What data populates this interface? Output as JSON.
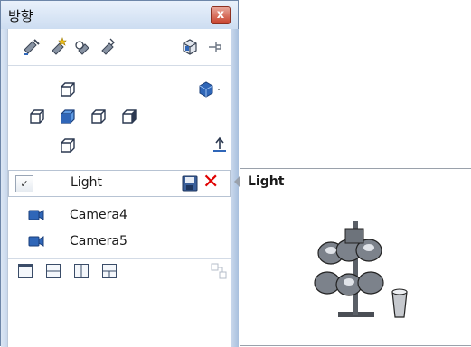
{
  "window": {
    "title": "방향",
    "close_label": "x"
  },
  "toolbar": {
    "icons": [
      "camera-new-icon",
      "camera-star-icon",
      "camera-previous-icon",
      "camera-link-icon",
      "view-cube-icon",
      "pin-icon"
    ]
  },
  "views": {
    "icons": [
      "top-view-icon",
      "display-style-dropdown-icon",
      "left-view-icon",
      "front-view-icon",
      "right-view-icon",
      "back-view-icon",
      "bottom-view-icon",
      "normal-to-icon"
    ]
  },
  "saved_views": {
    "editing": {
      "check": "✓",
      "name": "Light"
    },
    "items": [
      {
        "name": "Camera4"
      },
      {
        "name": "Camera5"
      }
    ]
  },
  "layout": {
    "icons": [
      "single-viewport-icon",
      "two-horizontal-viewports-icon",
      "two-vertical-viewports-icon",
      "four-viewports-icon",
      "link-views-icon"
    ]
  },
  "preview": {
    "title": "Light"
  },
  "colors": {
    "accent_blue": "#2f66b8",
    "delete_red": "#e00000"
  }
}
